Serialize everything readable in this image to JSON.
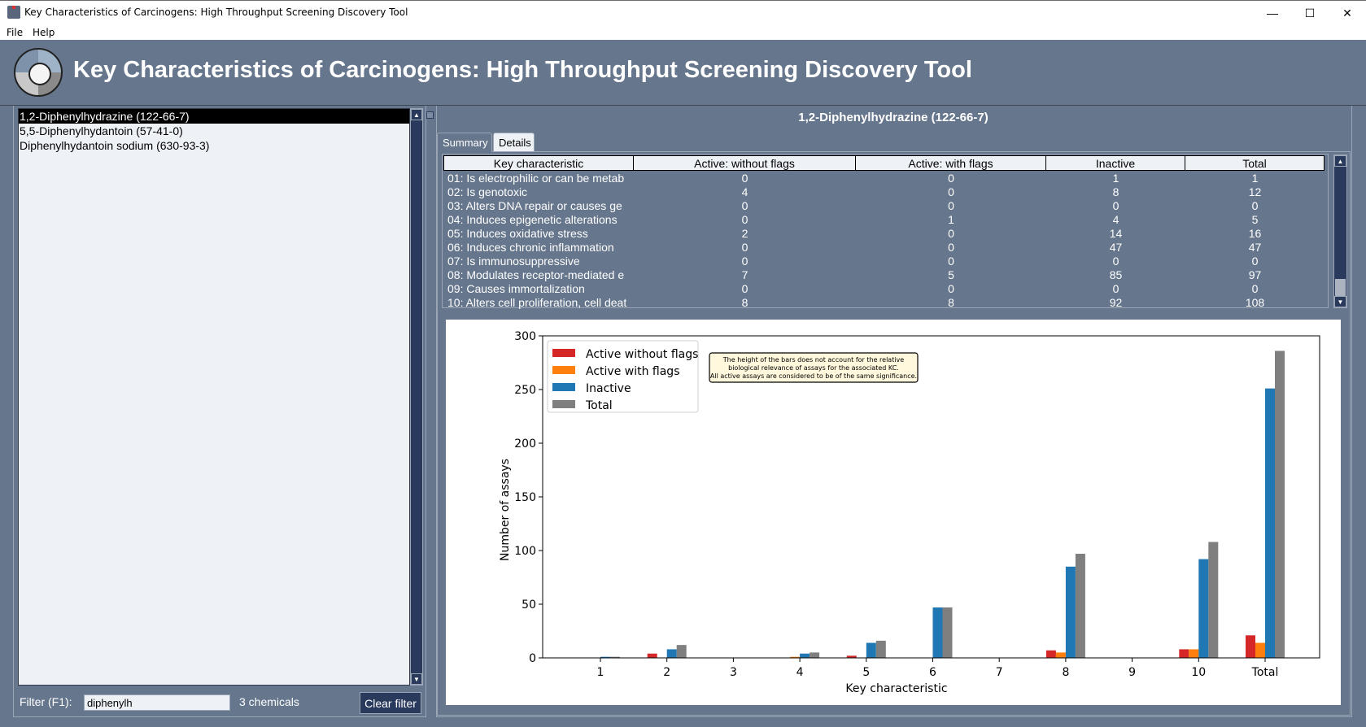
{
  "window": {
    "title": "Key Characteristics of Carcinogens: High Throughput Screening Discovery Tool",
    "minimize_glyph": "—",
    "maximize_glyph": "☐",
    "close_glyph": "✕"
  },
  "menu": {
    "file": "File",
    "help": "Help"
  },
  "banner": {
    "heading": "Key Characteristics of Carcinogens: High Throughput Screening Discovery Tool"
  },
  "chemicals": [
    {
      "label": "1,2-Diphenylhydrazine (122-66-7)",
      "selected": true
    },
    {
      "label": "5,5-Diphenylhydantoin (57-41-0)",
      "selected": false
    },
    {
      "label": "Diphenylhydantoin sodium (630-93-3)",
      "selected": false
    }
  ],
  "filter": {
    "label": "Filter (F1):",
    "value": "diphenylh",
    "count": "3 chemicals",
    "clear_label": "Clear filter"
  },
  "detail": {
    "chemical_title": "1,2-Diphenylhydrazine (122-66-7)",
    "tabs": [
      {
        "label": "Summary",
        "active": true
      },
      {
        "label": "Details",
        "active": false
      }
    ],
    "table": {
      "headers": [
        "Key characteristic",
        "Active: without flags",
        "Active: with flags",
        "Inactive",
        "Total"
      ],
      "rows": [
        [
          "01: Is electrophilic or can be metab",
          "0",
          "0",
          "1",
          "1"
        ],
        [
          "02: Is genotoxic",
          "4",
          "0",
          "8",
          "12"
        ],
        [
          "03: Alters DNA repair or causes ge",
          "0",
          "0",
          "0",
          "0"
        ],
        [
          "04: Induces epigenetic alterations",
          "0",
          "1",
          "4",
          "5"
        ],
        [
          "05: Induces oxidative stress",
          "2",
          "0",
          "14",
          "16"
        ],
        [
          "06: Induces chronic inflammation",
          "0",
          "0",
          "47",
          "47"
        ],
        [
          "07: Is immunosuppressive",
          "0",
          "0",
          "0",
          "0"
        ],
        [
          "08: Modulates receptor-mediated e",
          "7",
          "5",
          "85",
          "97"
        ],
        [
          "09: Causes immortalization",
          "0",
          "0",
          "0",
          "0"
        ],
        [
          "10: Alters cell proliferation, cell deat",
          "8",
          "8",
          "92",
          "108"
        ]
      ]
    }
  },
  "chart_data": {
    "type": "bar",
    "title": "",
    "xlabel": "Key characteristic",
    "ylabel": "Number of assays",
    "categories": [
      "1",
      "2",
      "3",
      "4",
      "5",
      "6",
      "7",
      "8",
      "9",
      "10",
      "Total"
    ],
    "series": [
      {
        "name": "Active without flags",
        "color": "#d62728",
        "values": [
          0,
          4,
          0,
          0,
          2,
          0,
          0,
          7,
          0,
          8,
          21
        ]
      },
      {
        "name": "Active with flags",
        "color": "#ff7f0e",
        "values": [
          0,
          0,
          0,
          1,
          0,
          0,
          0,
          5,
          0,
          8,
          14
        ]
      },
      {
        "name": "Inactive",
        "color": "#1f77b4",
        "values": [
          1,
          8,
          0,
          4,
          14,
          47,
          0,
          85,
          0,
          92,
          251
        ]
      },
      {
        "name": "Total",
        "color": "#7f7f7f",
        "values": [
          1,
          12,
          0,
          5,
          16,
          47,
          0,
          97,
          0,
          108,
          286
        ]
      }
    ],
    "ylim": [
      0,
      300
    ],
    "yticks": [
      0,
      50,
      100,
      150,
      200,
      250,
      300
    ],
    "grid": false,
    "legend_position": "top-left",
    "annotation": [
      "The height of the bars does not account for the relative",
      "biological relevance of assays for the associated KC.",
      "All active assays are considered to be of the same significance."
    ]
  }
}
